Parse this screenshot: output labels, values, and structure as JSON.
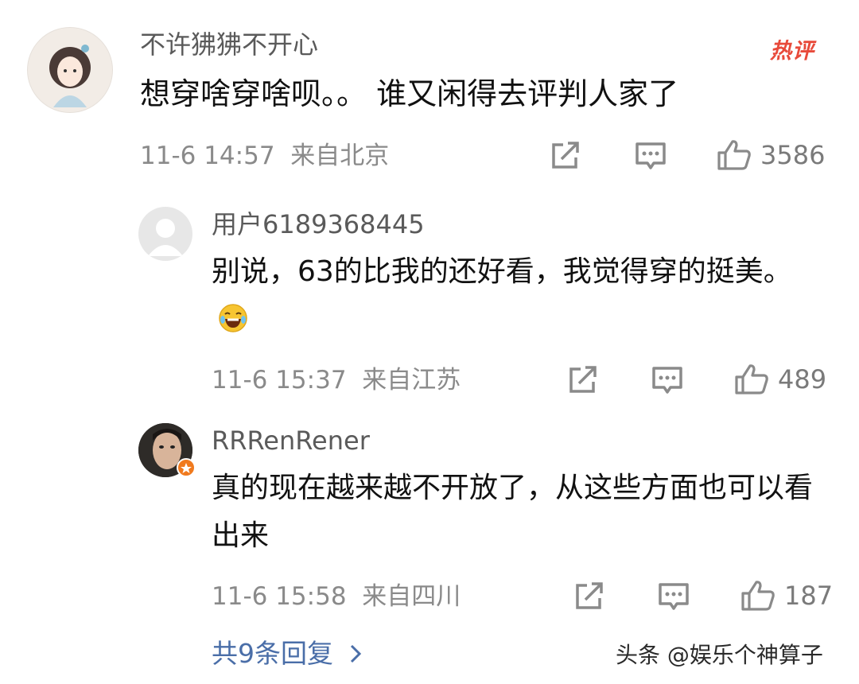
{
  "comment": {
    "username": "不许狒狒不开心",
    "badge": "热评",
    "text": "想穿啥穿啥呗。。 谁又闲得去评判人家了",
    "time": "11-6 14:57",
    "location": "来自北京",
    "likes": "3586"
  },
  "replies": [
    {
      "username": "用户6189368445",
      "text": "别说，63的比我的还好看，我觉得穿的挺美。",
      "emoji": "😂",
      "time": "11-6 15:37",
      "location": "来自江苏",
      "likes": "489"
    },
    {
      "username": "RRRenRener",
      "text": "真的现在越来越不开放了，从这些方面也可以看出来",
      "time": "11-6 15:58",
      "location": "来自四川",
      "likes": "187"
    }
  ],
  "more_replies": "共9条回复",
  "watermark": "头条 @娱乐个神算子",
  "icons": [
    "share-icon",
    "comment-icon",
    "like-icon",
    "chevron-right-icon",
    "emoji-laugh-icon"
  ],
  "colors": {
    "hot_badge": "#e84a3a",
    "link": "#4a6ea8",
    "meta": "#8a8a8a"
  }
}
